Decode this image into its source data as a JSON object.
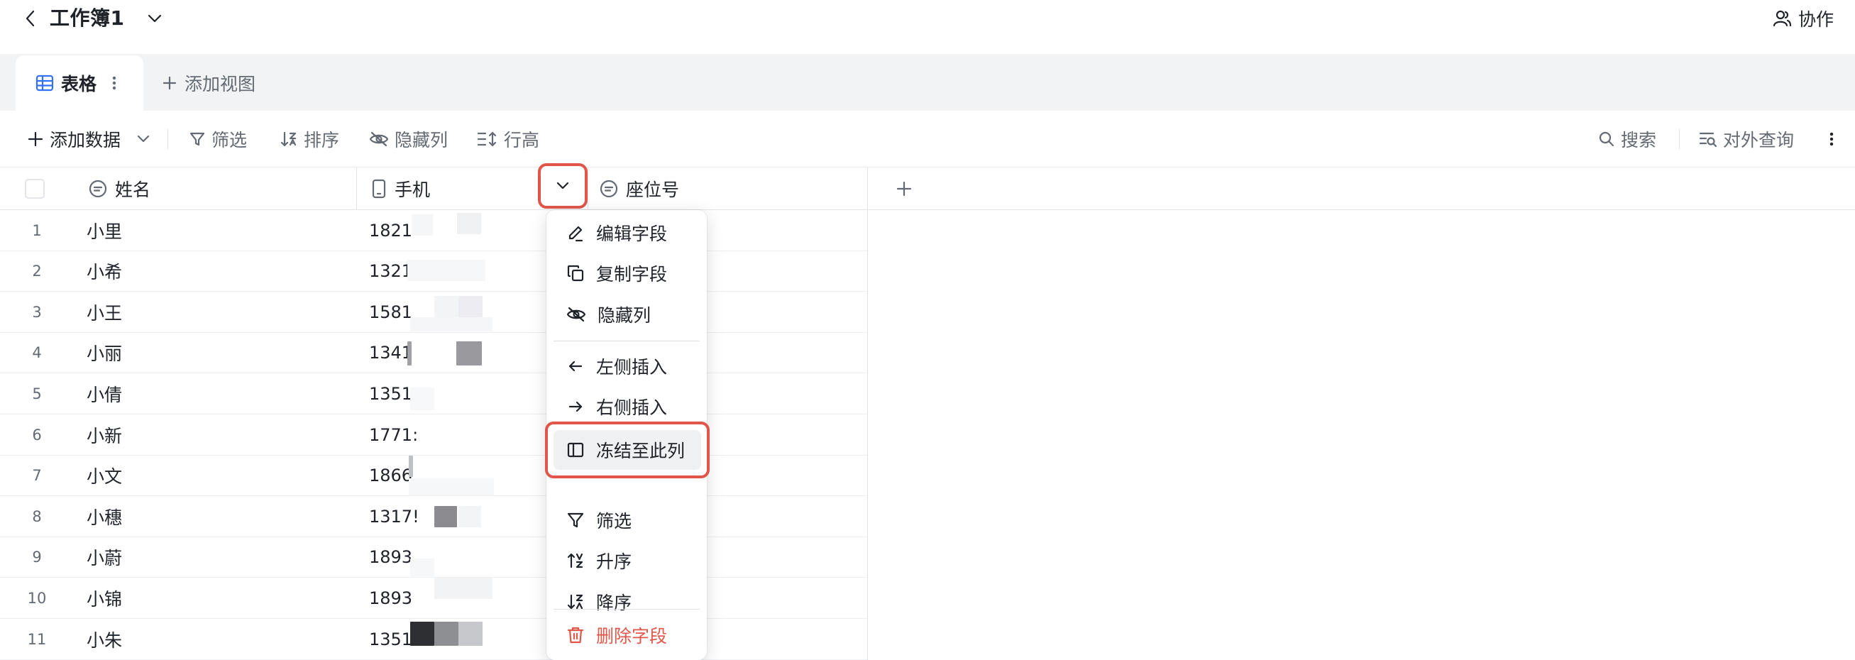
{
  "header": {
    "title": "工作簿1",
    "collab_label": "协作"
  },
  "tabs": {
    "active_label": "表格",
    "add_view_label": "添加视图"
  },
  "toolbar": {
    "add_data": "添加数据",
    "filter": "筛选",
    "sort": "排序",
    "hide_cols": "隐藏列",
    "row_height": "行高",
    "search": "搜索",
    "external_query": "对外查询"
  },
  "columns": {
    "name": "姓名",
    "phone": "手机",
    "seat": "座位号",
    "add": "+"
  },
  "rows": [
    {
      "num": "1",
      "name": "小里",
      "phone": "1821"
    },
    {
      "num": "2",
      "name": "小希",
      "phone": "1321"
    },
    {
      "num": "3",
      "name": "小王",
      "phone": "1581"
    },
    {
      "num": "4",
      "name": "小丽",
      "phone": "1341"
    },
    {
      "num": "5",
      "name": "小倩",
      "phone": "1351"
    },
    {
      "num": "6",
      "name": "小新",
      "phone": "1771:"
    },
    {
      "num": "7",
      "name": "小文",
      "phone": "1866"
    },
    {
      "num": "8",
      "name": "小穗",
      "phone": "1317!"
    },
    {
      "num": "9",
      "name": "小蔚",
      "phone": "1893"
    },
    {
      "num": "10",
      "name": "小锦",
      "phone": "1893"
    },
    {
      "num": "11",
      "name": "小朱",
      "phone": "1351"
    }
  ],
  "menu": {
    "edit_field": "编辑字段",
    "duplicate_field": "复制字段",
    "hide_column": "隐藏列",
    "insert_left": "左侧插入",
    "insert_right": "右侧插入",
    "freeze": "冻结至此列",
    "filter": "筛选",
    "ascending": "升序",
    "descending": "降序",
    "delete_field": "删除字段"
  },
  "colors": {
    "accent_highlight": "#e0574a",
    "danger": "#e0574a",
    "tab_icon": "#3370ff"
  }
}
